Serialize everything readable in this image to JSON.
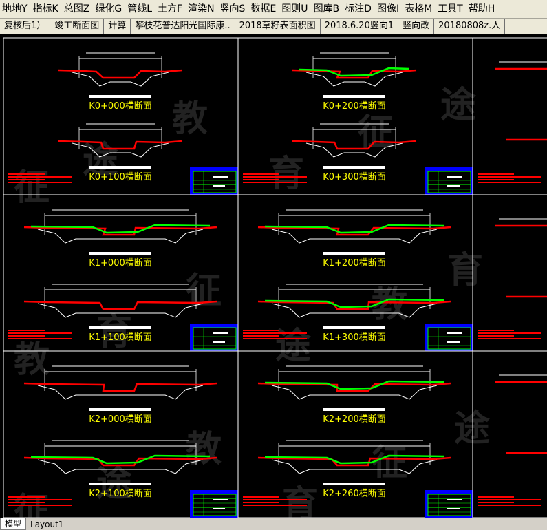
{
  "menu": [
    "地地Y",
    "指标K",
    "总图Z",
    "绿化G",
    "管线L",
    "土方F",
    "渲染N",
    "竖向S",
    "数据E",
    "图则U",
    "图库B",
    "标注D",
    "图像I",
    "表格M",
    "工具T",
    "帮助H"
  ],
  "doc_tabs": [
    "复核后1）",
    "竣工断面图",
    "计算",
    "攀枝花普达阳光国际康..",
    "2018草籽表面积图",
    "2018.6.20竖向1",
    "竖向改",
    "20180808z.人"
  ],
  "sections": {
    "c0": [
      "K0+000横断面",
      "K0+100横断面"
    ],
    "c1": [
      "K0+200横断面",
      "K0+300横断面"
    ],
    "r1c0": [
      "K1+000横断面",
      "K1+100横断面"
    ],
    "r1c1": [
      "K1+200横断面",
      "K1+300横断面"
    ],
    "r2c0": [
      "K2+000横断面",
      "K2+100横断面"
    ],
    "r2c1": [
      "K2+200横断面",
      "K2+260横断面"
    ]
  },
  "watermark": [
    "征",
    "途",
    "教",
    "育"
  ],
  "layout_tabs": [
    "模型",
    "Layout1"
  ],
  "colors": {
    "canvas": "#000000",
    "existing_ground": "#ff0000",
    "design_line": "#00ff00",
    "frame": "#ffffff",
    "title_block": "#0000ff",
    "label": "#ffff00"
  }
}
